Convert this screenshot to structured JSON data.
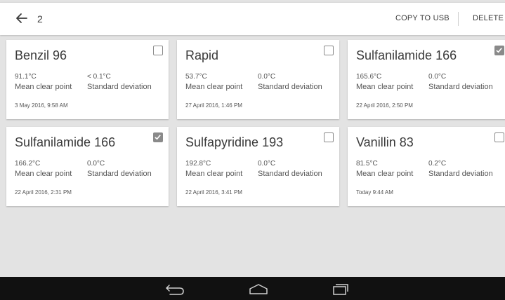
{
  "header": {
    "selected_count": "2",
    "copy_label": "COPY TO USB",
    "delete_label": "DELETE",
    "back_icon": "arrow-left-icon"
  },
  "cards": [
    {
      "title": "Benzil 96",
      "checked": false,
      "mean_value": "91.1°C",
      "mean_label": "Mean clear point",
      "sd_value": "< 0.1°C",
      "sd_label": "Standard deviation",
      "timestamp": "3 May 2016, 9:58 AM"
    },
    {
      "title": "Rapid",
      "checked": false,
      "mean_value": "53.7°C",
      "mean_label": "Mean clear point",
      "sd_value": "0.0°C",
      "sd_label": "Standard deviation",
      "timestamp": "27 April 2016, 1:46 PM"
    },
    {
      "title": "Sulfanilamide 166",
      "checked": true,
      "mean_value": "165.6°C",
      "mean_label": "Mean clear point",
      "sd_value": "0.0°C",
      "sd_label": "Standard deviation",
      "timestamp": "22 April 2016, 2:50 PM"
    },
    {
      "title": "Sulfanilamide 166",
      "checked": true,
      "mean_value": "166.2°C",
      "mean_label": "Mean clear point",
      "sd_value": "0.0°C",
      "sd_label": "Standard deviation",
      "timestamp": "22 April 2016, 2:31 PM"
    },
    {
      "title": "Sulfapyridine 193",
      "checked": false,
      "mean_value": "192.8°C",
      "mean_label": "Mean clear point",
      "sd_value": "0.0°C",
      "sd_label": "Standard deviation",
      "timestamp": "22 April 2016, 3:41 PM"
    },
    {
      "title": "Vanillin 83",
      "checked": false,
      "mean_value": "81.5°C",
      "mean_label": "Mean clear point",
      "sd_value": "0.2°C",
      "sd_label": "Standard deviation",
      "timestamp": "Today 9:44 AM"
    }
  ],
  "navbar": {
    "buttons": [
      "back-nav-icon",
      "home-nav-icon",
      "recents-nav-icon"
    ]
  },
  "colors": {
    "background": "#e3e3e3",
    "card": "#ffffff",
    "navbar": "#111111",
    "checkbox": "#8a8a8a"
  }
}
